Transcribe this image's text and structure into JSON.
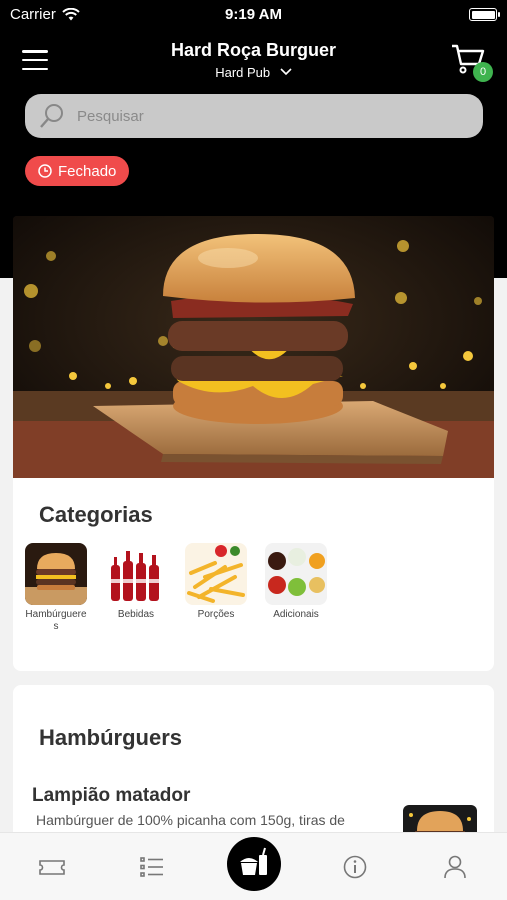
{
  "status_bar": {
    "carrier": "Carrier",
    "time": "9:19 AM"
  },
  "header": {
    "title": "Hard Roça Burguer",
    "subtitle": "Hard Pub",
    "cart_count": "0"
  },
  "search": {
    "placeholder": "Pesquisar"
  },
  "store_status": "Fechado",
  "categories": {
    "title": "Categorias",
    "items": [
      {
        "label": "Hambúrgueres",
        "icon": "burger-photo"
      },
      {
        "label": "Bebidas",
        "icon": "drinks-photo"
      },
      {
        "label": "Porções",
        "icon": "fries-photo"
      },
      {
        "label": "Adicionais",
        "icon": "sauces-photo"
      }
    ]
  },
  "section": {
    "title": "Hambúrguers",
    "product": {
      "name": "Lampião matador",
      "description": "Hambúrguer de 100%  picanha com  150g, tiras de"
    }
  },
  "tabbar": {
    "items": [
      {
        "icon": "ticket-icon"
      },
      {
        "icon": "list-icon"
      },
      {
        "icon": "food-icon"
      },
      {
        "icon": "info-icon"
      },
      {
        "icon": "user-icon"
      }
    ]
  },
  "colors": {
    "closed_badge": "#f04b4b",
    "cart_badge": "#3fb34f",
    "header_bg": "#000000"
  }
}
